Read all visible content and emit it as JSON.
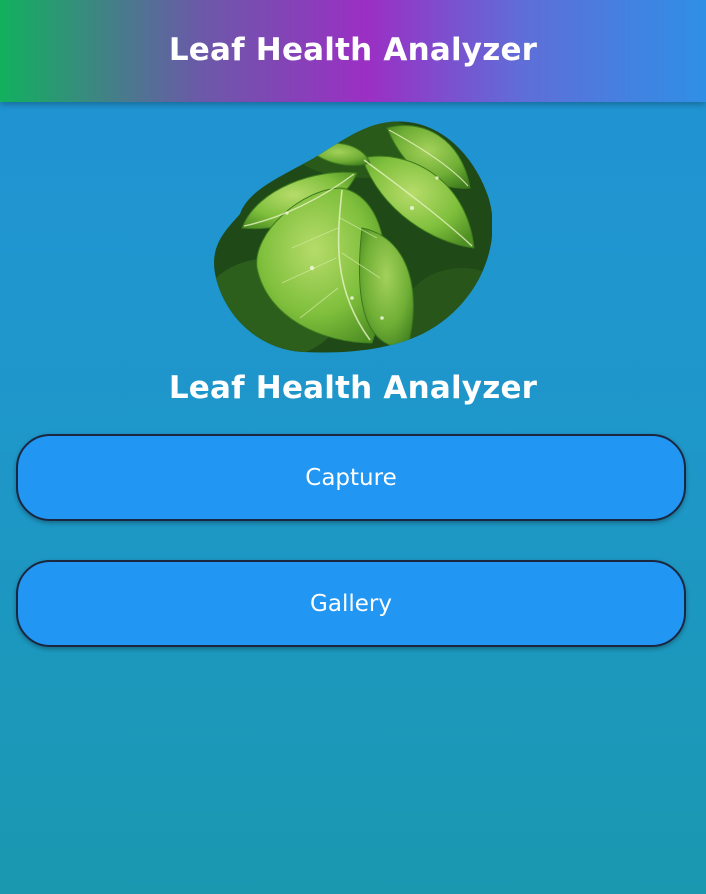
{
  "app_bar": {
    "title": "Leaf Health Analyzer"
  },
  "hero": {
    "image_name": "leaf-photo",
    "heading": "Leaf Health Analyzer"
  },
  "actions": {
    "capture_label": "Capture",
    "gallery_label": "Gallery"
  },
  "colors": {
    "button_fill": "#2196f3",
    "button_border": "#1b2740",
    "text": "#ffffff"
  }
}
